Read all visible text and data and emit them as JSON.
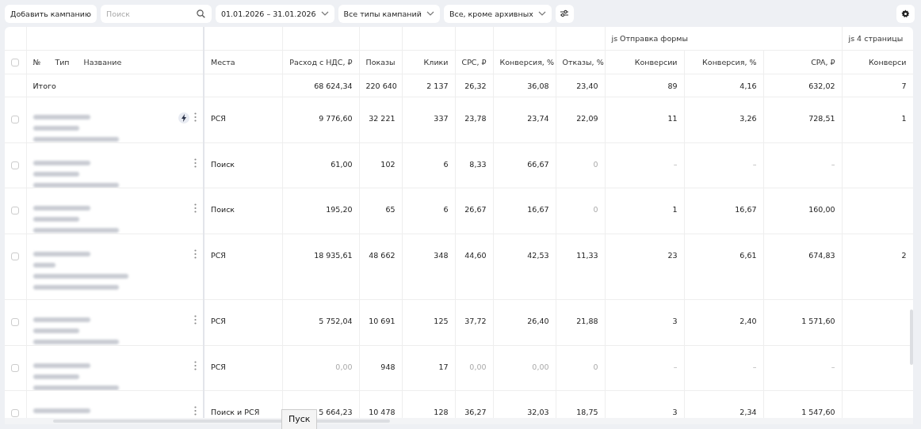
{
  "toolbar": {
    "add_button": "Добавить кампанию",
    "search": {
      "placeholder": "Поиск"
    },
    "date_range": "01.01.2026 – 31.01.2026",
    "type_filter": "Все типы кампаний",
    "status_filter": "Все, кроме архивных"
  },
  "table": {
    "name_headers": [
      "№",
      "Тип",
      "Название"
    ],
    "header_checked": false,
    "groups": [
      {
        "columns": [
          "Места",
          "Расход с НДС, ₽",
          "Показы",
          "Клики",
          "CPC, ₽",
          "Конверсия, %",
          "Отказы, %"
        ]
      },
      {
        "label": "js Отправка формы",
        "columns": [
          "Конверсии",
          "Конверсия, %",
          "CPA, ₽"
        ]
      },
      {
        "label": "js 4 страницы",
        "columns": [
          "Конверси"
        ]
      }
    ],
    "total": {
      "label": "Итого",
      "cells": [
        null,
        {
          "value": "68 624,34",
          "muted": false
        },
        {
          "value": "220 640",
          "muted": false
        },
        {
          "value": "2 137",
          "muted": false
        },
        {
          "value": "26,32",
          "muted": false
        },
        {
          "value": "36,08",
          "muted": false
        },
        {
          "value": "23,40",
          "muted": false
        },
        {
          "value": "89",
          "muted": false
        },
        {
          "value": "4,16",
          "muted": false
        },
        {
          "value": "632,02",
          "muted": false
        },
        {
          "value": "7",
          "muted": false
        }
      ]
    },
    "rows": [
      {
        "checked": false,
        "lightning": true,
        "name_wraps": false,
        "cells": [
          {
            "value": "РСЯ",
            "muted": false
          },
          {
            "value": "9 776,60",
            "muted": false
          },
          {
            "value": "32 221",
            "muted": false
          },
          {
            "value": "337",
            "muted": false
          },
          {
            "value": "23,78",
            "muted": false
          },
          {
            "value": "23,74",
            "muted": false
          },
          {
            "value": "22,09",
            "muted": false
          },
          {
            "value": "11",
            "muted": false
          },
          {
            "value": "3,26",
            "muted": false
          },
          {
            "value": "728,51",
            "muted": false
          },
          {
            "value": "1",
            "muted": false
          }
        ]
      },
      {
        "checked": false,
        "lightning": false,
        "name_wraps": false,
        "cells": [
          {
            "value": "Поиск",
            "muted": false
          },
          {
            "value": "61,00",
            "muted": false
          },
          {
            "value": "102",
            "muted": false
          },
          {
            "value": "6",
            "muted": false
          },
          {
            "value": "8,33",
            "muted": false
          },
          {
            "value": "66,67",
            "muted": false
          },
          {
            "value": "0",
            "muted": true
          },
          {
            "value": "–",
            "muted": true
          },
          {
            "value": "–",
            "muted": true
          },
          {
            "value": "–",
            "muted": true
          },
          null
        ]
      },
      {
        "checked": false,
        "lightning": false,
        "name_wraps": false,
        "cells": [
          {
            "value": "Поиск",
            "muted": false
          },
          {
            "value": "195,20",
            "muted": false
          },
          {
            "value": "65",
            "muted": false
          },
          {
            "value": "6",
            "muted": false
          },
          {
            "value": "26,67",
            "muted": false
          },
          {
            "value": "16,67",
            "muted": false
          },
          {
            "value": "0",
            "muted": true
          },
          {
            "value": "1",
            "muted": false
          },
          {
            "value": "16,67",
            "muted": false
          },
          {
            "value": "160,00",
            "muted": false
          },
          null
        ]
      },
      {
        "checked": false,
        "lightning": false,
        "name_wraps": true,
        "cells": [
          {
            "value": "РСЯ",
            "muted": false
          },
          {
            "value": "18 935,61",
            "muted": false
          },
          {
            "value": "48 662",
            "muted": false
          },
          {
            "value": "348",
            "muted": false
          },
          {
            "value": "44,60",
            "muted": false
          },
          {
            "value": "42,53",
            "muted": false
          },
          {
            "value": "11,33",
            "muted": false
          },
          {
            "value": "23",
            "muted": false
          },
          {
            "value": "6,61",
            "muted": false
          },
          {
            "value": "674,83",
            "muted": false
          },
          {
            "value": "2",
            "muted": false
          }
        ]
      },
      {
        "checked": false,
        "lightning": false,
        "name_wraps": false,
        "cells": [
          {
            "value": "РСЯ",
            "muted": false
          },
          {
            "value": "5 752,04",
            "muted": false
          },
          {
            "value": "10 691",
            "muted": false
          },
          {
            "value": "125",
            "muted": false
          },
          {
            "value": "37,72",
            "muted": false
          },
          {
            "value": "26,40",
            "muted": false
          },
          {
            "value": "21,88",
            "muted": false
          },
          {
            "value": "3",
            "muted": false
          },
          {
            "value": "2,40",
            "muted": false
          },
          {
            "value": "1 571,60",
            "muted": false
          },
          null
        ]
      },
      {
        "checked": false,
        "lightning": false,
        "name_wraps": false,
        "cells": [
          {
            "value": "РСЯ",
            "muted": false
          },
          {
            "value": "0,00",
            "muted": true
          },
          {
            "value": "948",
            "muted": false
          },
          {
            "value": "17",
            "muted": false
          },
          {
            "value": "0,00",
            "muted": true
          },
          {
            "value": "0,00",
            "muted": true
          },
          {
            "value": "0",
            "muted": true
          },
          {
            "value": "–",
            "muted": true
          },
          {
            "value": "–",
            "muted": true
          },
          {
            "value": "–",
            "muted": true
          },
          null
        ]
      },
      {
        "checked": false,
        "lightning": false,
        "name_wraps": false,
        "cells": [
          {
            "value": "Поиск и РСЯ",
            "muted": false
          },
          {
            "value": "5 664,23",
            "muted": false
          },
          {
            "value": "10 478",
            "muted": false
          },
          {
            "value": "128",
            "muted": false
          },
          {
            "value": "36,27",
            "muted": false
          },
          {
            "value": "32,03",
            "muted": false
          },
          {
            "value": "18,75",
            "muted": false
          },
          {
            "value": "3",
            "muted": false
          },
          {
            "value": "2,34",
            "muted": false
          },
          {
            "value": "1 547,60",
            "muted": false
          },
          null
        ]
      }
    ]
  },
  "tooltip": "Пуск"
}
